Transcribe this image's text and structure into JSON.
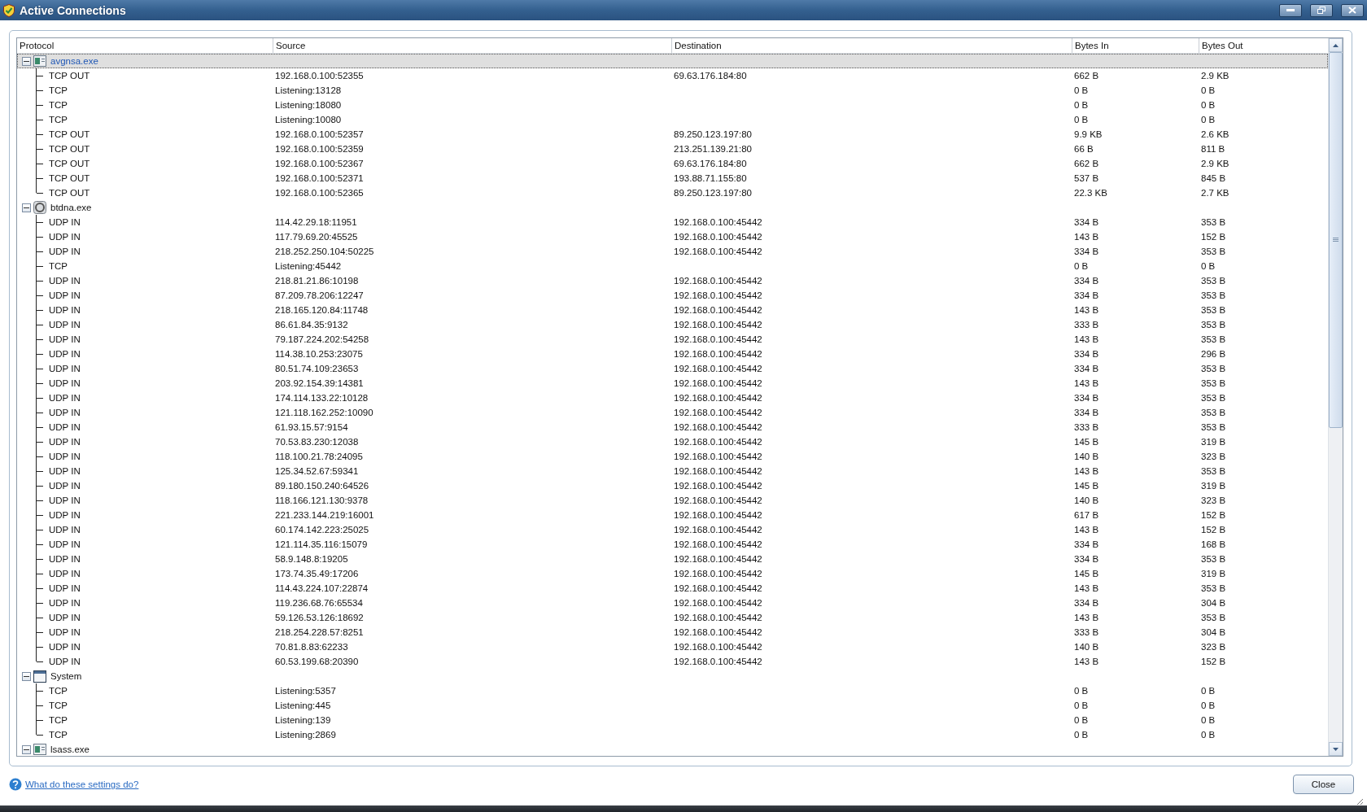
{
  "window": {
    "title": "Active Connections"
  },
  "table": {
    "columns": [
      "Protocol",
      "Source",
      "Destination",
      "Bytes In",
      "Bytes Out"
    ],
    "groups": [
      {
        "name": "avgnsa.exe",
        "kind": "program",
        "expanded": true,
        "selected": true,
        "connections": [
          {
            "protocol": "TCP OUT",
            "source": "192.168.0.100:52355",
            "destination": "69.63.176.184:80",
            "bytes_in": "662 B",
            "bytes_out": "2.9 KB"
          },
          {
            "protocol": "TCP",
            "source": "Listening:13128",
            "bytes_in": "0 B",
            "bytes_out": "0 B"
          },
          {
            "protocol": "TCP",
            "source": "Listening:18080",
            "bytes_in": "0 B",
            "bytes_out": "0 B"
          },
          {
            "protocol": "TCP",
            "source": "Listening:10080",
            "bytes_in": "0 B",
            "bytes_out": "0 B"
          },
          {
            "protocol": "TCP OUT",
            "source": "192.168.0.100:52357",
            "destination": "89.250.123.197:80",
            "bytes_in": "9.9 KB",
            "bytes_out": "2.6 KB"
          },
          {
            "protocol": "TCP OUT",
            "source": "192.168.0.100:52359",
            "destination": "213.251.139.21:80",
            "bytes_in": "66 B",
            "bytes_out": "811 B"
          },
          {
            "protocol": "TCP OUT",
            "source": "192.168.0.100:52367",
            "destination": "69.63.176.184:80",
            "bytes_in": "662 B",
            "bytes_out": "2.9 KB"
          },
          {
            "protocol": "TCP OUT",
            "source": "192.168.0.100:52371",
            "destination": "193.88.71.155:80",
            "bytes_in": "537 B",
            "bytes_out": "845 B"
          },
          {
            "protocol": "TCP OUT",
            "source": "192.168.0.100:52365",
            "destination": "89.250.123.197:80",
            "bytes_in": "22.3 KB",
            "bytes_out": "2.7 KB"
          }
        ]
      },
      {
        "name": "btdna.exe",
        "kind": "service",
        "expanded": true,
        "selected": false,
        "connections": [
          {
            "protocol": "UDP IN",
            "source": "114.42.29.18:11951",
            "destination": "192.168.0.100:45442",
            "bytes_in": "334 B",
            "bytes_out": "353 B"
          },
          {
            "protocol": "UDP IN",
            "source": "117.79.69.20:45525",
            "destination": "192.168.0.100:45442",
            "bytes_in": "143 B",
            "bytes_out": "152 B"
          },
          {
            "protocol": "UDP IN",
            "source": "218.252.250.104:50225",
            "destination": "192.168.0.100:45442",
            "bytes_in": "334 B",
            "bytes_out": "353 B"
          },
          {
            "protocol": "TCP",
            "source": "Listening:45442",
            "bytes_in": "0 B",
            "bytes_out": "0 B"
          },
          {
            "protocol": "UDP IN",
            "source": "218.81.21.86:10198",
            "destination": "192.168.0.100:45442",
            "bytes_in": "334 B",
            "bytes_out": "353 B"
          },
          {
            "protocol": "UDP IN",
            "source": "87.209.78.206:12247",
            "destination": "192.168.0.100:45442",
            "bytes_in": "334 B",
            "bytes_out": "353 B"
          },
          {
            "protocol": "UDP IN",
            "source": "218.165.120.84:11748",
            "destination": "192.168.0.100:45442",
            "bytes_in": "143 B",
            "bytes_out": "353 B"
          },
          {
            "protocol": "UDP IN",
            "source": "86.61.84.35:9132",
            "destination": "192.168.0.100:45442",
            "bytes_in": "333 B",
            "bytes_out": "353 B"
          },
          {
            "protocol": "UDP IN",
            "source": "79.187.224.202:54258",
            "destination": "192.168.0.100:45442",
            "bytes_in": "143 B",
            "bytes_out": "353 B"
          },
          {
            "protocol": "UDP IN",
            "source": "114.38.10.253:23075",
            "destination": "192.168.0.100:45442",
            "bytes_in": "334 B",
            "bytes_out": "296 B"
          },
          {
            "protocol": "UDP IN",
            "source": "80.51.74.109:23653",
            "destination": "192.168.0.100:45442",
            "bytes_in": "334 B",
            "bytes_out": "353 B"
          },
          {
            "protocol": "UDP IN",
            "source": "203.92.154.39:14381",
            "destination": "192.168.0.100:45442",
            "bytes_in": "143 B",
            "bytes_out": "353 B"
          },
          {
            "protocol": "UDP IN",
            "source": "174.114.133.22:10128",
            "destination": "192.168.0.100:45442",
            "bytes_in": "334 B",
            "bytes_out": "353 B"
          },
          {
            "protocol": "UDP IN",
            "source": "121.118.162.252:10090",
            "destination": "192.168.0.100:45442",
            "bytes_in": "334 B",
            "bytes_out": "353 B"
          },
          {
            "protocol": "UDP IN",
            "source": "61.93.15.57:9154",
            "destination": "192.168.0.100:45442",
            "bytes_in": "333 B",
            "bytes_out": "353 B"
          },
          {
            "protocol": "UDP IN",
            "source": "70.53.83.230:12038",
            "destination": "192.168.0.100:45442",
            "bytes_in": "145 B",
            "bytes_out": "319 B"
          },
          {
            "protocol": "UDP IN",
            "source": "118.100.21.78:24095",
            "destination": "192.168.0.100:45442",
            "bytes_in": "140 B",
            "bytes_out": "323 B"
          },
          {
            "protocol": "UDP IN",
            "source": "125.34.52.67:59341",
            "destination": "192.168.0.100:45442",
            "bytes_in": "143 B",
            "bytes_out": "353 B"
          },
          {
            "protocol": "UDP IN",
            "source": "89.180.150.240:64526",
            "destination": "192.168.0.100:45442",
            "bytes_in": "145 B",
            "bytes_out": "319 B"
          },
          {
            "protocol": "UDP IN",
            "source": "118.166.121.130:9378",
            "destination": "192.168.0.100:45442",
            "bytes_in": "140 B",
            "bytes_out": "323 B"
          },
          {
            "protocol": "UDP IN",
            "source": "221.233.144.219:16001",
            "destination": "192.168.0.100:45442",
            "bytes_in": "617 B",
            "bytes_out": "152 B"
          },
          {
            "protocol": "UDP IN",
            "source": "60.174.142.223:25025",
            "destination": "192.168.0.100:45442",
            "bytes_in": "143 B",
            "bytes_out": "152 B"
          },
          {
            "protocol": "UDP IN",
            "source": "121.114.35.116:15079",
            "destination": "192.168.0.100:45442",
            "bytes_in": "334 B",
            "bytes_out": "168 B"
          },
          {
            "protocol": "UDP IN",
            "source": "58.9.148.8:19205",
            "destination": "192.168.0.100:45442",
            "bytes_in": "334 B",
            "bytes_out": "353 B"
          },
          {
            "protocol": "UDP IN",
            "source": "173.74.35.49:17206",
            "destination": "192.168.0.100:45442",
            "bytes_in": "145 B",
            "bytes_out": "319 B"
          },
          {
            "protocol": "UDP IN",
            "source": "114.43.224.107:22874",
            "destination": "192.168.0.100:45442",
            "bytes_in": "143 B",
            "bytes_out": "353 B"
          },
          {
            "protocol": "UDP IN",
            "source": "119.236.68.76:65534",
            "destination": "192.168.0.100:45442",
            "bytes_in": "334 B",
            "bytes_out": "304 B"
          },
          {
            "protocol": "UDP IN",
            "source": "59.126.53.126:18692",
            "destination": "192.168.0.100:45442",
            "bytes_in": "143 B",
            "bytes_out": "353 B"
          },
          {
            "protocol": "UDP IN",
            "source": "218.254.228.57:8251",
            "destination": "192.168.0.100:45442",
            "bytes_in": "333 B",
            "bytes_out": "304 B"
          },
          {
            "protocol": "UDP IN",
            "source": "70.81.8.83:62233",
            "destination": "192.168.0.100:45442",
            "bytes_in": "140 B",
            "bytes_out": "323 B"
          },
          {
            "protocol": "UDP IN",
            "source": "60.53.199.68:20390",
            "destination": "192.168.0.100:45442",
            "bytes_in": "143 B",
            "bytes_out": "152 B"
          }
        ]
      },
      {
        "name": "System",
        "kind": "system",
        "expanded": true,
        "selected": false,
        "connections": [
          {
            "protocol": "TCP",
            "source": "Listening:5357",
            "bytes_in": "0 B",
            "bytes_out": "0 B"
          },
          {
            "protocol": "TCP",
            "source": "Listening:445",
            "bytes_in": "0 B",
            "bytes_out": "0 B"
          },
          {
            "protocol": "TCP",
            "source": "Listening:139",
            "bytes_in": "0 B",
            "bytes_out": "0 B"
          },
          {
            "protocol": "TCP",
            "source": "Listening:2869",
            "bytes_in": "0 B",
            "bytes_out": "0 B"
          }
        ]
      },
      {
        "name": "lsass.exe",
        "kind": "program",
        "expanded": true,
        "selected": false
      }
    ]
  },
  "help_link": "What do these settings do?",
  "buttons": [
    {
      "label": "Close"
    }
  ]
}
